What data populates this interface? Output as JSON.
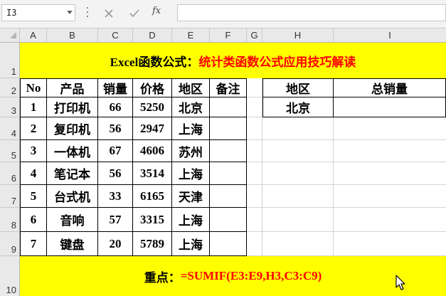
{
  "formula_bar": {
    "name_box": "I3",
    "fx_label": "fx",
    "formula": ""
  },
  "columns": [
    "A",
    "B",
    "C",
    "D",
    "E",
    "F",
    "G",
    "H",
    "I"
  ],
  "rows": [
    "1",
    "2",
    "3",
    "4",
    "5",
    "6",
    "7",
    "8",
    "9",
    "10"
  ],
  "title": {
    "part1": "Excel函数公式：",
    "part2": "统计类函数公式应用技巧解读"
  },
  "data_table": {
    "headers": [
      "No",
      "产品",
      "销量",
      "价格",
      "地区",
      "备注"
    ],
    "rows": [
      [
        "1",
        "打印机",
        "66",
        "5250",
        "北京",
        ""
      ],
      [
        "2",
        "复印机",
        "56",
        "2947",
        "上海",
        ""
      ],
      [
        "3",
        "一体机",
        "67",
        "4606",
        "苏州",
        ""
      ],
      [
        "4",
        "笔记本",
        "56",
        "3514",
        "上海",
        ""
      ],
      [
        "5",
        "台式机",
        "33",
        "6165",
        "天津",
        ""
      ],
      [
        "6",
        "音响",
        "57",
        "3315",
        "上海",
        ""
      ],
      [
        "7",
        "键盘",
        "20",
        "5789",
        "上海",
        ""
      ]
    ]
  },
  "lookup_table": {
    "headers": [
      "地区",
      "总销量"
    ],
    "row": [
      "北京",
      ""
    ]
  },
  "footer": {
    "label": "重点：",
    "formula": "=SUMIF(E3:E9,H3,C3:C9)"
  },
  "colors": {
    "highlight": "#ffff00",
    "emphasis": "#ff0000"
  }
}
